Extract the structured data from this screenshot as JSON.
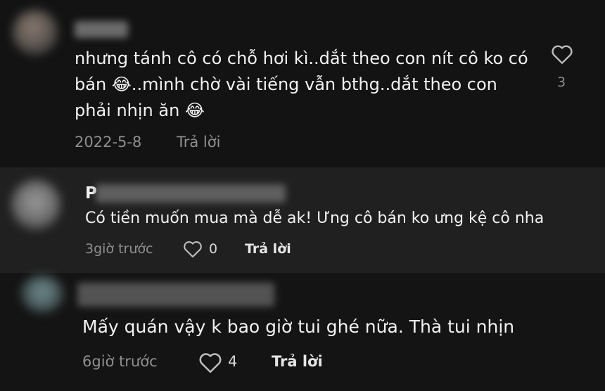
{
  "comments": [
    {
      "name": "",
      "lines": [
        "nhưng tánh cô có chỗ hơi kì..dắt theo con nít cô ko có",
        "bán 😂..mình chờ vài tiếng vẫn bthg..dắt theo con",
        "phải nhịn ăn 😂"
      ],
      "date": "2022-5-8",
      "reply_label": "Trả lời",
      "likes": "3"
    },
    {
      "name_initial": "P",
      "text": "Có tiền muốn mua mà dễ ak! Ưng cô bán ko ưng kệ cô nha",
      "time": "3giờ trước",
      "likes": "0",
      "reply_label": "Trả lời"
    },
    {
      "name": "",
      "text": "Mấy quán vậy k bao giờ tui ghé nữa. Thà tui nhịn",
      "time": "6giờ trước",
      "likes": "4",
      "reply_label": "Trả lời"
    }
  ],
  "icons": {
    "like": "heart-outline-icon"
  },
  "colors": {
    "background": "#121212",
    "text": "#f2f2f2",
    "muted": "#8f8f8f"
  }
}
